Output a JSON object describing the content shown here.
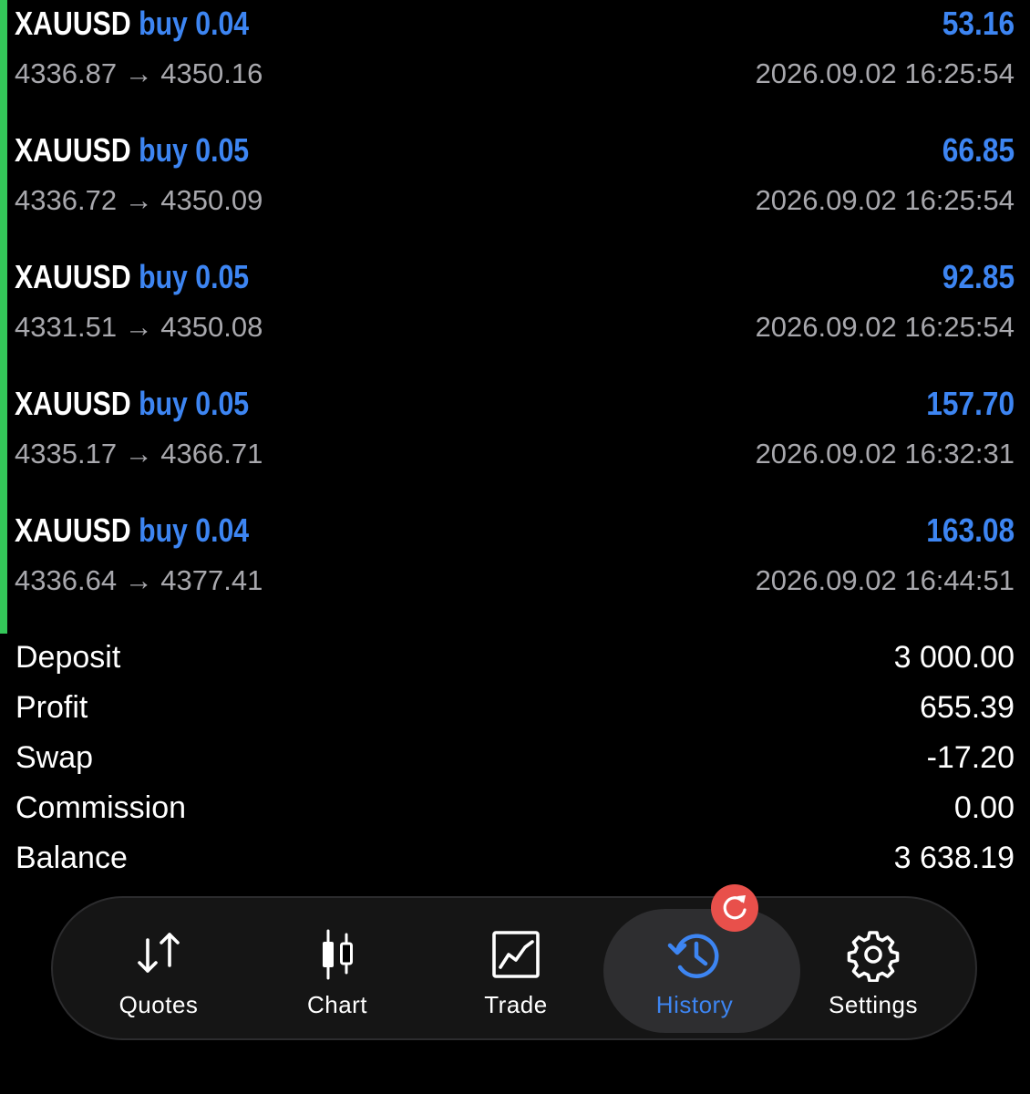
{
  "deals": [
    {
      "symbol": "XAUUSD",
      "side": "buy 0.04",
      "profit": "53.16",
      "prices": "4336.87 → 4350.16",
      "time": "2026.09.02 16:25:54"
    },
    {
      "symbol": "XAUUSD",
      "side": "buy 0.05",
      "profit": "66.85",
      "prices": "4336.72 → 4350.09",
      "time": "2026.09.02 16:25:54"
    },
    {
      "symbol": "XAUUSD",
      "side": "buy 0.05",
      "profit": "92.85",
      "prices": "4331.51 → 4350.08",
      "time": "2026.09.02 16:25:54"
    },
    {
      "symbol": "XAUUSD",
      "side": "buy 0.05",
      "profit": "157.70",
      "prices": "4335.17 → 4366.71",
      "time": "2026.09.02 16:32:31"
    },
    {
      "symbol": "XAUUSD",
      "side": "buy 0.04",
      "profit": "163.08",
      "prices": "4336.64 → 4377.41",
      "time": "2026.09.02 16:44:51"
    }
  ],
  "summary": [
    {
      "label": "Deposit",
      "value": "3 000.00"
    },
    {
      "label": "Profit",
      "value": "655.39"
    },
    {
      "label": "Swap",
      "value": "-17.20"
    },
    {
      "label": "Commission",
      "value": "0.00"
    },
    {
      "label": "Balance",
      "value": "3 638.19"
    }
  ],
  "tabbar": {
    "tabs": [
      {
        "label": "Quotes",
        "icon": "quotes-arrows-icon",
        "active": false
      },
      {
        "label": "Chart",
        "icon": "candlestick-chart-icon",
        "active": false
      },
      {
        "label": "Trade",
        "icon": "trade-chart-icon",
        "active": false
      },
      {
        "label": "History",
        "icon": "history-clock-icon",
        "active": true
      },
      {
        "label": "Settings",
        "icon": "gear-icon",
        "active": false
      }
    ],
    "badge_icon": "refresh-icon"
  },
  "colors": {
    "accent": "#3d85f2",
    "profit_bar": "#34c759",
    "secondary_text": "#a8a8ad",
    "badge": "#e8504b",
    "background": "#000000"
  }
}
